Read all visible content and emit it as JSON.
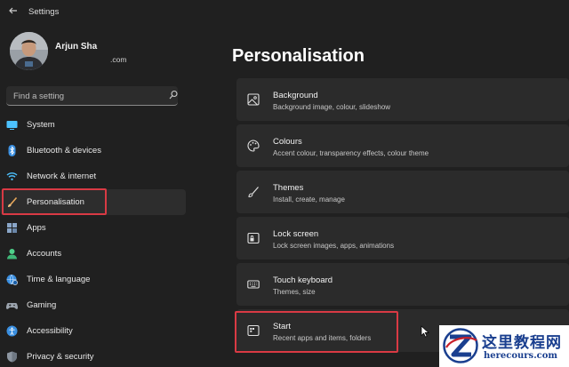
{
  "window": {
    "title": "Settings"
  },
  "profile": {
    "name": "Arjun Sha",
    "email": ".com"
  },
  "search": {
    "placeholder": "Find a setting"
  },
  "sidebar": {
    "items": [
      {
        "label": "System",
        "icon": "monitor-icon"
      },
      {
        "label": "Bluetooth & devices",
        "icon": "bluetooth-icon"
      },
      {
        "label": "Network & internet",
        "icon": "wifi-icon"
      },
      {
        "label": "Personalisation",
        "icon": "brush-icon",
        "active": true
      },
      {
        "label": "Apps",
        "icon": "apps-icon"
      },
      {
        "label": "Accounts",
        "icon": "person-icon"
      },
      {
        "label": "Time & language",
        "icon": "globe-clock-icon"
      },
      {
        "label": "Gaming",
        "icon": "gamepad-icon"
      },
      {
        "label": "Accessibility",
        "icon": "accessibility-icon"
      },
      {
        "label": "Privacy & security",
        "icon": "shield-icon"
      }
    ]
  },
  "main": {
    "title": "Personalisation",
    "cards": [
      {
        "title": "Background",
        "desc": "Background image, colour, slideshow",
        "icon": "image-icon"
      },
      {
        "title": "Colours",
        "desc": "Accent colour, transparency effects, colour theme",
        "icon": "palette-icon"
      },
      {
        "title": "Themes",
        "desc": "Install, create, manage",
        "icon": "brush-icon"
      },
      {
        "title": "Lock screen",
        "desc": "Lock screen images, apps, animations",
        "icon": "lock-screen-icon"
      },
      {
        "title": "Touch keyboard",
        "desc": "Themes, size",
        "icon": "keyboard-icon"
      },
      {
        "title": "Start",
        "desc": "Recent apps and items, folders",
        "icon": "start-menu-icon"
      }
    ]
  },
  "watermark": {
    "cn": "这里教程网",
    "en": "herecours.com"
  },
  "colors": {
    "background": "#202020",
    "card": "#2b2b2b",
    "highlight": "#d93a44",
    "accent": "#4cc2ff"
  }
}
